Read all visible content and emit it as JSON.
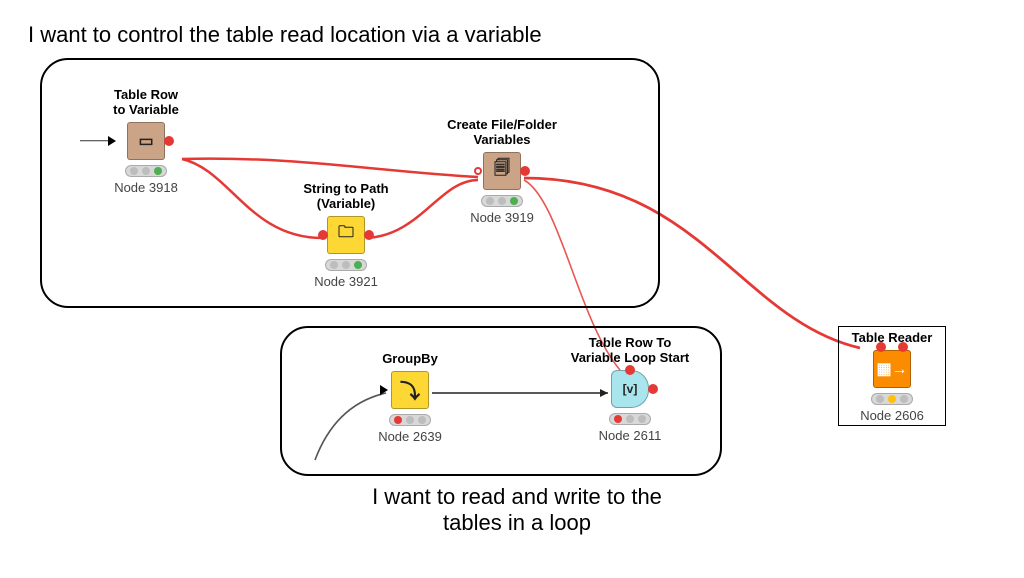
{
  "annotations": {
    "top": "I want to control the table read location via a variable",
    "bottom_line1": "I want to read and write to the",
    "bottom_line2": "tables in a loop"
  },
  "nodes": {
    "n3918": {
      "title_l1": "Table Row",
      "title_l2": "to Variable",
      "id": "Node 3918",
      "status": "green",
      "color": "tan"
    },
    "n3921": {
      "title_l1": "String to Path",
      "title_l2": "(Variable)",
      "id": "Node 3921",
      "status": "green",
      "color": "yellow"
    },
    "n3919": {
      "title_l1": "Create File/Folder",
      "title_l2": "Variables",
      "id": "Node 3919",
      "status": "green",
      "color": "tan"
    },
    "n2639": {
      "title_l1": "GroupBy",
      "title_l2": "",
      "id": "Node 2639",
      "status": "red",
      "color": "yellow"
    },
    "n2611": {
      "title_l1": "Table Row To",
      "title_l2": "Variable Loop Start",
      "id": "Node 2611",
      "status": "red",
      "color": "cyan"
    },
    "n2606": {
      "title_l1": "Table Reader",
      "title_l2": "",
      "id": "Node 2606",
      "status": "yellow",
      "color": "orange"
    }
  },
  "groups": {
    "top": "variable-control-group",
    "bottom": "loop-group"
  },
  "colors": {
    "variable_wire": "#e53935",
    "data_wire": "#555"
  }
}
